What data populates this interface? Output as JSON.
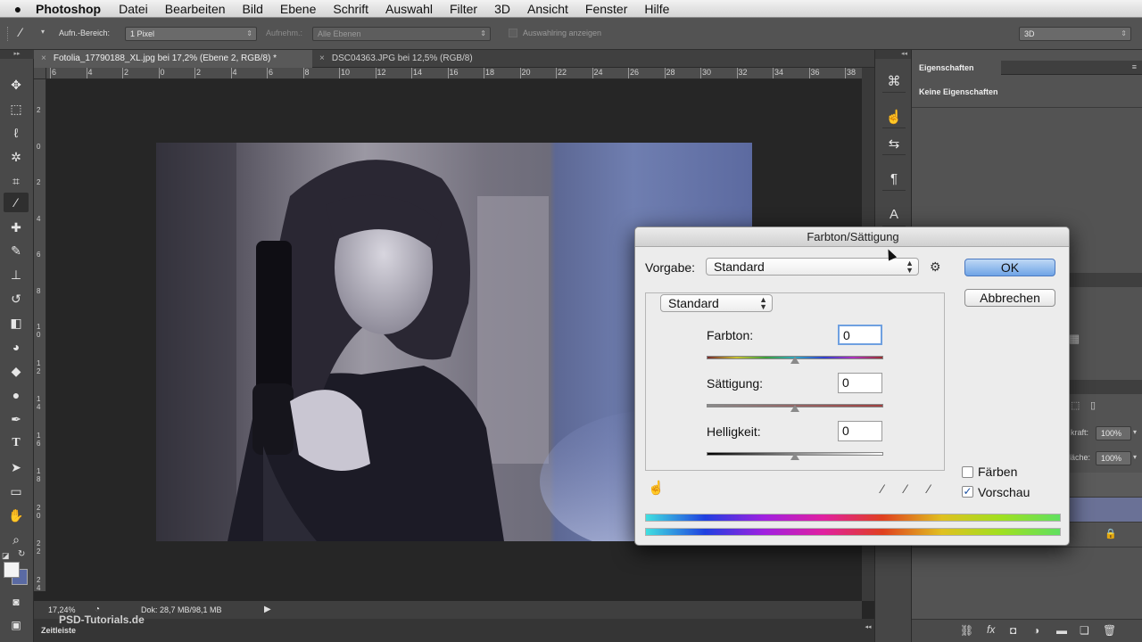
{
  "menubar": {
    "apple_icon": "apple-icon",
    "app": "Photoshop",
    "items": [
      "Datei",
      "Bearbeiten",
      "Bild",
      "Ebene",
      "Schrift",
      "Auswahl",
      "Filter",
      "3D",
      "Ansicht",
      "Fenster",
      "Hilfe"
    ]
  },
  "options": {
    "sample_label": "Aufn.-Bereich:",
    "sample_value": "1 Pixel",
    "sample2_label": "Aufnehm.:",
    "layers_value": "Alle Ebenen",
    "ring_label": "Auswahlring anzeigen",
    "mode_value": "3D"
  },
  "tabs": [
    {
      "label": "Fotolia_17790188_XL.jpg bei 17,2% (Ebene 2, RGB/8) *",
      "active": true
    },
    {
      "label": "DSC04363.JPG bei 12,5% (RGB/8)",
      "active": false
    }
  ],
  "ruler": {
    "h_ticks": [
      "6",
      "4",
      "2",
      "0",
      "2",
      "4",
      "6",
      "8",
      "10",
      "12",
      "14",
      "16",
      "18",
      "20",
      "22",
      "24",
      "26",
      "28",
      "30",
      "32",
      "34",
      "36",
      "38"
    ],
    "v_ticks": [
      "2",
      "0",
      "2",
      "4",
      "6",
      "8",
      "1 0",
      "1 2",
      "1 4",
      "1 6",
      "1 8",
      "2 0",
      "2 2",
      "2 4"
    ]
  },
  "status": {
    "zoom": "17,24%",
    "doc": "Dok: 28,7 MB/98,1 MB",
    "timeline": "Zeitleiste",
    "watermark": "PSD-Tutorials.de"
  },
  "panel": {
    "title": "Eigenschaften",
    "body": "Keine Eigenschaften",
    "opacity_label": "kraft:",
    "opacity_value": "100%",
    "fill_label": "läche:",
    "fill_value": "100%"
  },
  "dialog": {
    "title": "Farbton/Sättigung",
    "preset_label": "Vorgabe:",
    "preset_value": "Standard",
    "channel_value": "Standard",
    "ok": "OK",
    "cancel": "Abbrechen",
    "hue_label": "Farbton:",
    "hue_value": "0",
    "sat_label": "Sättigung:",
    "sat_value": "0",
    "light_label": "Helligkeit:",
    "light_value": "0",
    "colorize_label": "Färben",
    "colorize_checked": false,
    "preview_label": "Vorschau",
    "preview_checked": true,
    "checkmark": "✓"
  },
  "colors": {
    "ok_button": "#6fa4e6",
    "panel_bg": "#535353",
    "canvas_bg": "#262626",
    "dialog_bg": "#ececec"
  }
}
